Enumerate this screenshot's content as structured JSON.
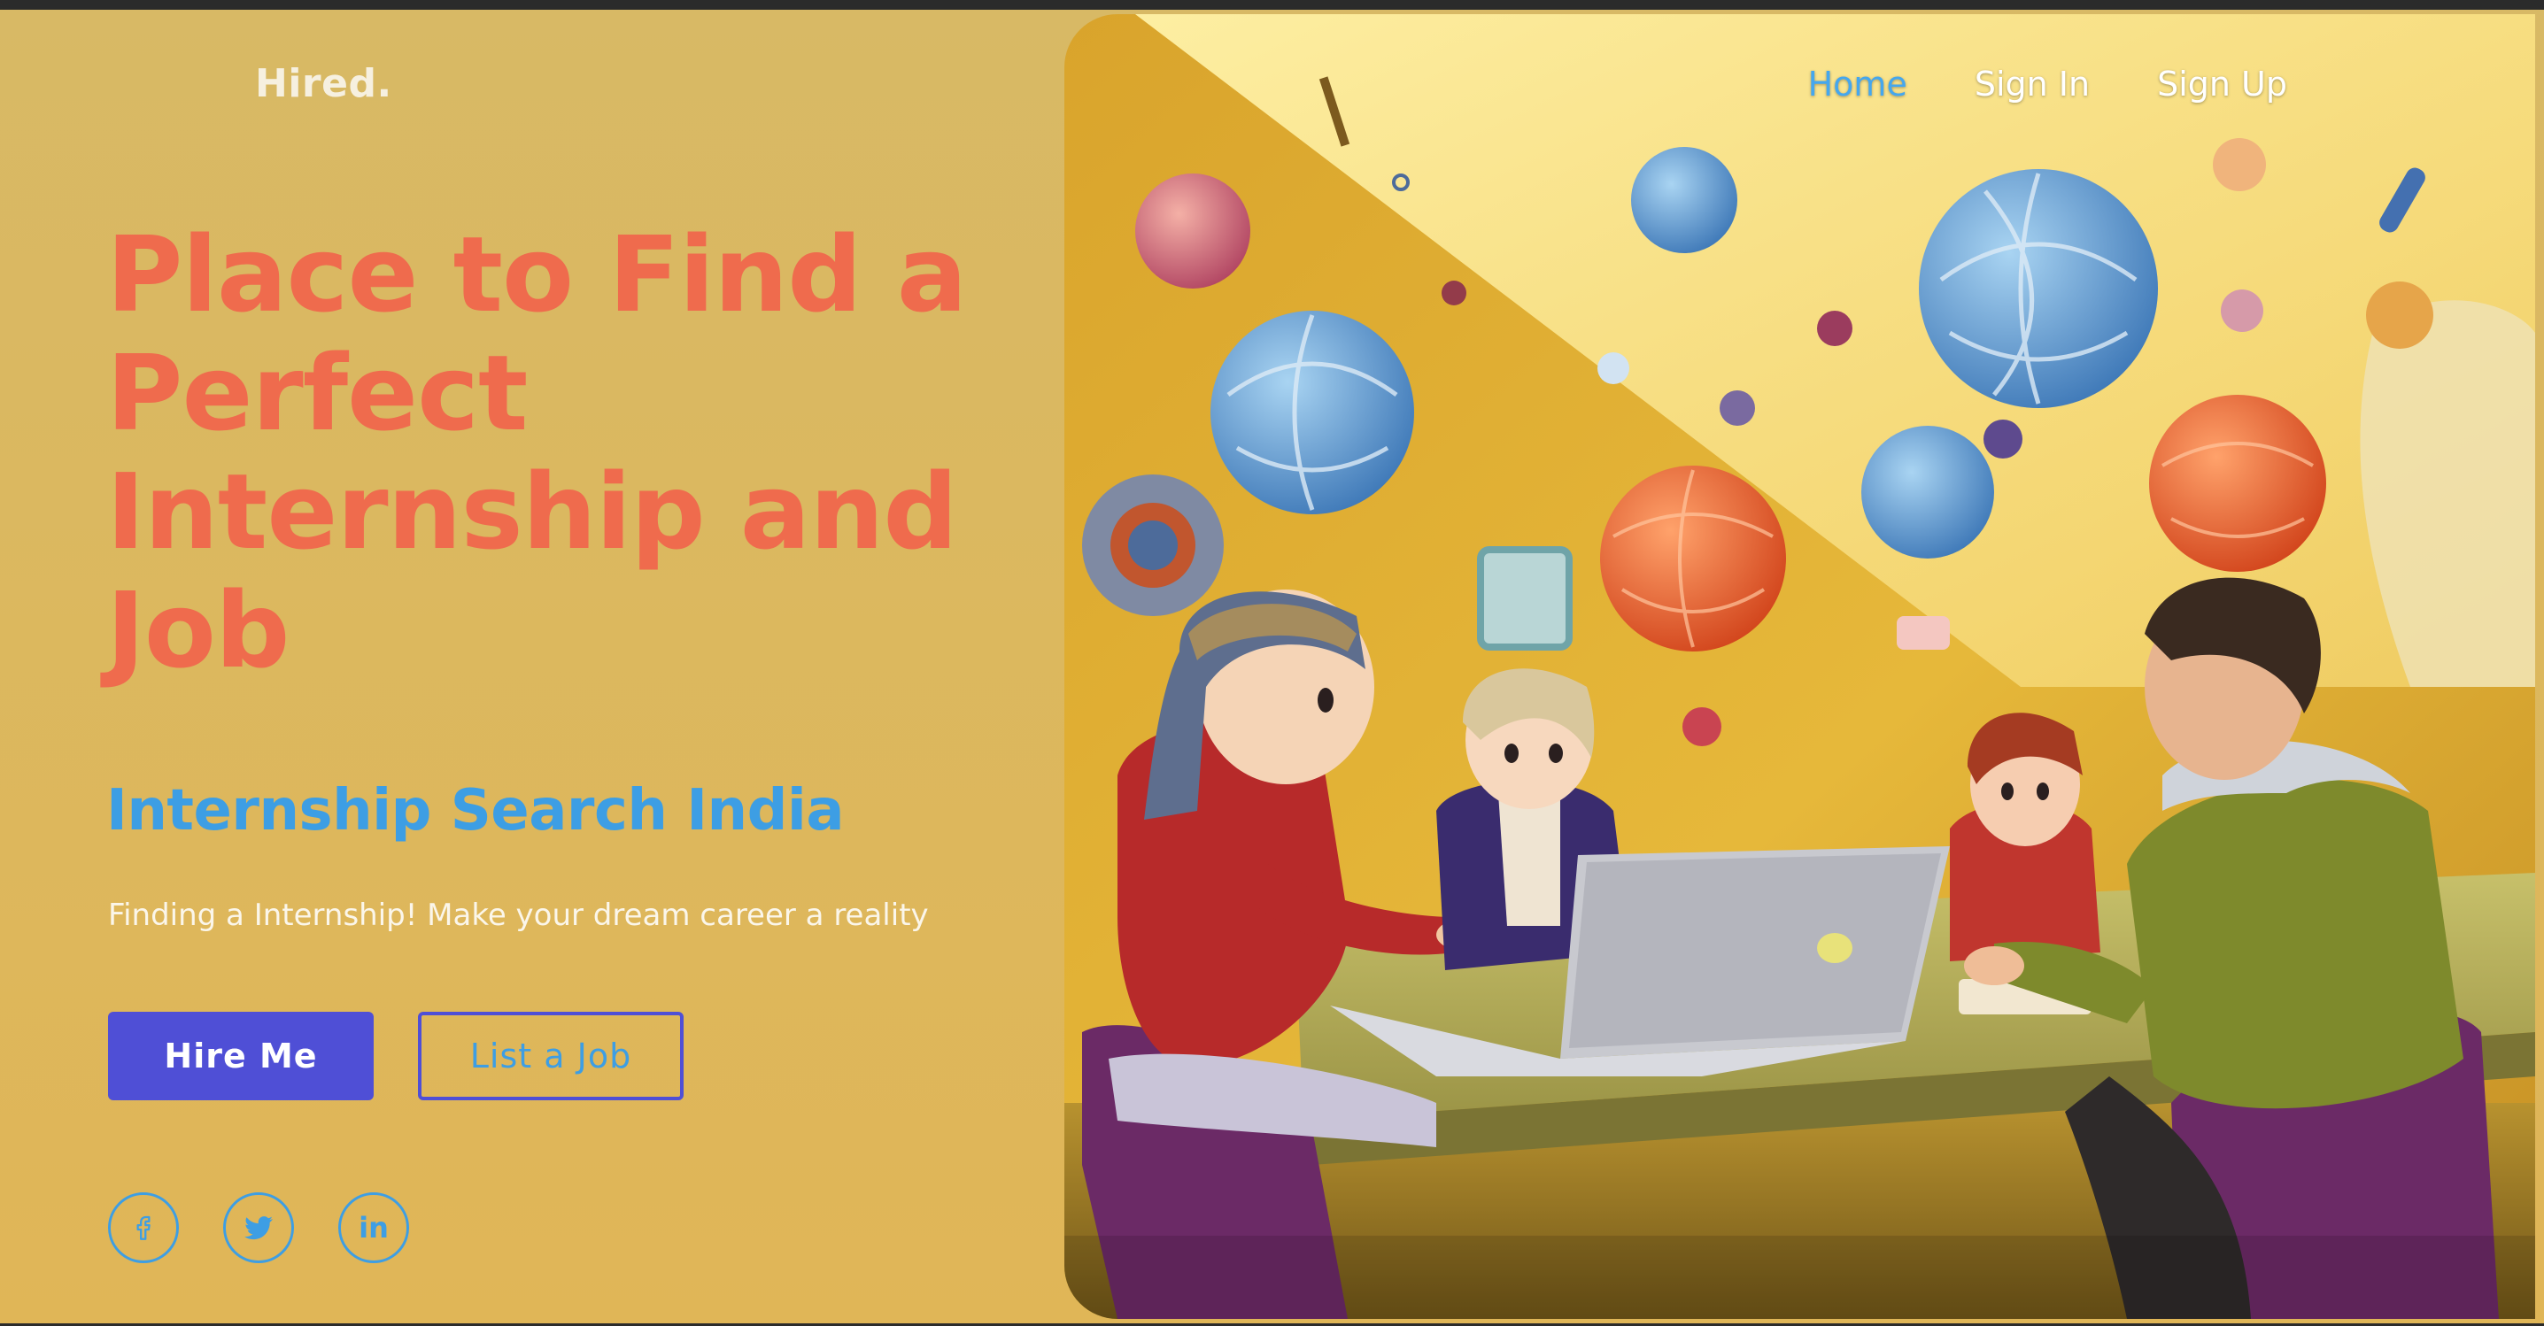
{
  "brand": {
    "name": "Hired."
  },
  "nav": {
    "items": [
      {
        "label": "Home",
        "active": true
      },
      {
        "label": "Sign In",
        "active": false
      },
      {
        "label": "Sign Up",
        "active": false
      }
    ]
  },
  "hero": {
    "headline": "Place to Find a Perfect Internship and Job",
    "subheadline": "Internship Search India",
    "tagline": "Finding a Internship! Make your dream career a reality",
    "primary_button": "Hire Me",
    "secondary_button": "List a Job",
    "socials": [
      {
        "icon": "facebook-icon"
      },
      {
        "icon": "twitter-icon"
      },
      {
        "icon": "linkedin-icon"
      }
    ],
    "image": "illustration of students working around a table with a laptop"
  },
  "colors": {
    "background": "#dcb85e",
    "headline": "#ef6b4d",
    "accent_blue": "#3d9ee4",
    "button": "#4f4fd6",
    "nav_active": "#45a7ee"
  }
}
